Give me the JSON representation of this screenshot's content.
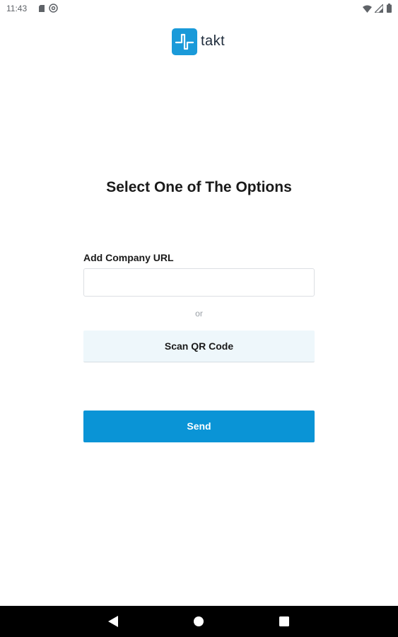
{
  "status_bar": {
    "time": "11:43",
    "icons": [
      "sd-card-icon",
      "at-sign-icon",
      "wifi-icon",
      "signal-icon",
      "battery-icon"
    ]
  },
  "header": {
    "brand_name": "takt",
    "logo_icon": "takt-logo-icon",
    "brand_color": "#1a9ad9"
  },
  "main": {
    "title": "Select One of The Options",
    "url_field": {
      "label": "Add Company URL",
      "value": "",
      "placeholder": ""
    },
    "separator_text": "or",
    "scan_button_label": "Scan QR Code",
    "send_button_label": "Send"
  },
  "colors": {
    "primary": "#0a94d6",
    "scan_button_bg": "#eef7fb",
    "nav_bar_bg": "#000000"
  },
  "nav_bar": {
    "icons": [
      "back-icon",
      "home-icon",
      "recents-icon"
    ]
  }
}
